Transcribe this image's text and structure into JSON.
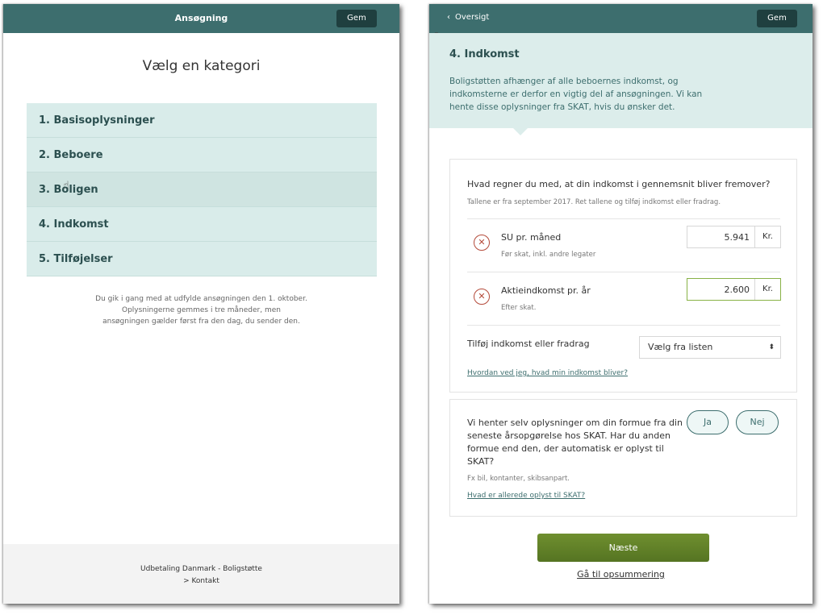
{
  "left": {
    "title": "Ansøgning",
    "save_label": "Gem",
    "heading": "Vælg en kategori",
    "categories": [
      {
        "label": "1. Basisoplysninger"
      },
      {
        "label": "2. Beboere"
      },
      {
        "label": "3. Boligen"
      },
      {
        "label": "4. Indkomst"
      },
      {
        "label": "5. Tilføjelser"
      }
    ],
    "info": {
      "line1": "Du gik i gang med at udfylde ansøgningen den 1. oktober.",
      "line2": "Oplysningerne gemmes i tre måneder, men",
      "line3": "ansøgningen gælder først fra den dag, du sender den."
    },
    "footer": {
      "org": "Udbetaling Danmark - Boligstøtte",
      "contact": "> Kontakt"
    }
  },
  "right": {
    "back_label": "Oversigt",
    "save_label": "Gem",
    "section_title": "4. Indkomst",
    "section_desc": "Boligstøtten afhænger af alle beboernes indkomst, og indkomsterne er derfor en vigtig del af ansøgningen. Vi kan hente disse oplysninger fra SKAT, hvis du ønsker det.",
    "income_card": {
      "question": "Hvad regner du med, at din indkomst i gennemsnit bliver fremover?",
      "subtitle": "Tallene er fra september 2017. Ret tallene og tilføj indkomst eller fradrag.",
      "rows": [
        {
          "label": "SU pr. måned",
          "note": "Før skat, inkl. andre legater",
          "value": "5.941",
          "unit": "Kr."
        },
        {
          "label": "Aktieindkomst pr. år",
          "note": "Efter skat.",
          "value": "2.600",
          "unit": "Kr."
        }
      ],
      "add_label": "Tilføj indkomst eller fradrag",
      "select_value": "Vælg fra listen",
      "help_link": "Hvordan ved jeg, hvad min indkomst bliver?"
    },
    "wealth_card": {
      "text": "Vi henter selv oplysninger om din formue fra din seneste årsopgørelse hos SKAT. Har du anden formue end den, der automatisk er oplyst til SKAT?",
      "yes": "Ja",
      "no": "Nej",
      "note": "Fx bil, kontanter, skibsanpart.",
      "link": "Hvad er allerede oplyst til SKAT?"
    },
    "next_label": "Næste",
    "summary_link": "Gå til opsummering"
  },
  "colors": {
    "header": "#3d6e6e",
    "save_button": "#1f3f3f",
    "category_bg": "#d9ecea",
    "category_text": "#2c5050",
    "intro_bg": "#dcedeb",
    "remove_icon": "#b44a3a",
    "focus_border": "#88b246",
    "next_button": "#5f7f28"
  },
  "icons": {
    "back": "chevron-left-icon",
    "remove": "close-circle-icon",
    "select": "sort-arrows-icon",
    "pointer": "hand-cursor-icon",
    "arrow_cursor": "arrow-cursor-icon"
  }
}
